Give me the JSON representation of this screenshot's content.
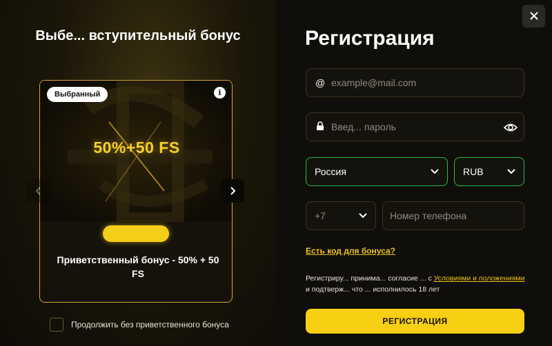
{
  "promo": {
    "title": "Выбе... вступительный бонус",
    "card": {
      "badge": "Выбранный",
      "info_icon": "info-icon",
      "amount": "50%+50 FS",
      "description": "Приветственный бонус - 50% + 50 FS"
    },
    "prev_icon": "chevron-left-icon",
    "next_icon": "chevron-right-icon",
    "skip_bonus_label": "Продолжить без приветственного бонуса",
    "skip_bonus_checked": false
  },
  "registration": {
    "title": "Регистрация",
    "close_icon": "close-icon",
    "email": {
      "icon": "at-icon",
      "placeholder": "example@mail.com",
      "value": ""
    },
    "password": {
      "icon": "lock-icon",
      "placeholder": "Введ... пароль",
      "value": "",
      "toggle_icon": "eye-icon"
    },
    "country": {
      "selected": "Россия"
    },
    "currency": {
      "selected": "RUB"
    },
    "phone_code": {
      "selected": "+7"
    },
    "phone": {
      "placeholder": "Номер телефона",
      "value": ""
    },
    "bonus_code_link": "Есть код для бонуса?",
    "terms": {
      "text_before": "Регистриру... принима... согласие ... с ",
      "link": "Условиями и положениями",
      "text_after": " и подтверж... что ... исполнилось 18 лет"
    },
    "submit_label": "РЕГИСТРАЦИЯ"
  },
  "colors": {
    "accent": "#f7cf13",
    "accent_link": "#f0c21e",
    "field_border": "#3b3421",
    "valid_border": "#2aba4f",
    "background": "#0f0e0a"
  }
}
